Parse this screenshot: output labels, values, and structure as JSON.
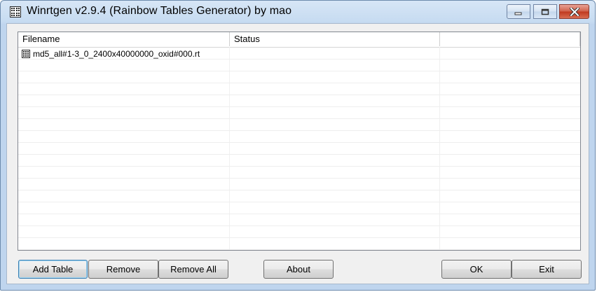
{
  "window": {
    "title": "Winrtgen v2.9.4 (Rainbow Tables Generator) by mao",
    "icon": "grid-app-icon",
    "controls": [
      "minimize",
      "maximize",
      "close"
    ]
  },
  "table": {
    "columns": [
      "Filename",
      "Status",
      ""
    ],
    "rows": [
      {
        "filename": "md5_all#1-3_0_2400x40000000_oxid#000.rt",
        "status": "",
        "extra": "",
        "icon": "table-file-icon"
      }
    ]
  },
  "buttons": {
    "add_table": "Add Table",
    "remove": "Remove",
    "remove_all": "Remove All",
    "about": "About",
    "ok": "OK",
    "exit": "Exit"
  },
  "colors": {
    "titlebar": "#c6dbf1",
    "close_button": "#c0391f",
    "client": "#f0f0f0"
  }
}
